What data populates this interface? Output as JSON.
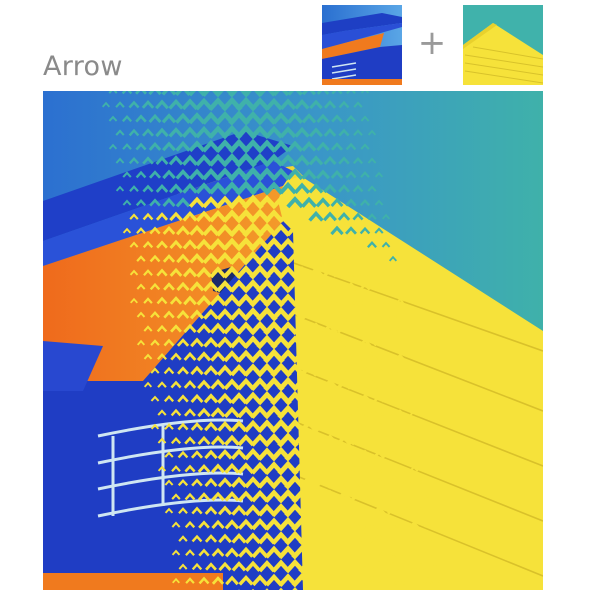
{
  "header": {
    "title": "Arrow",
    "operator": "+"
  },
  "thumbnails": [
    {
      "name": "source-building-blue-orange"
    },
    {
      "name": "source-building-yellow-teal"
    }
  ],
  "composite": {
    "pattern": "chevron-arrow",
    "colors": {
      "sky_blue": "#2f7fd4",
      "deep_blue": "#1f3fc8",
      "orange": "#f07a1e",
      "yellow": "#f6e23a",
      "teal": "#3fb1aa"
    }
  }
}
